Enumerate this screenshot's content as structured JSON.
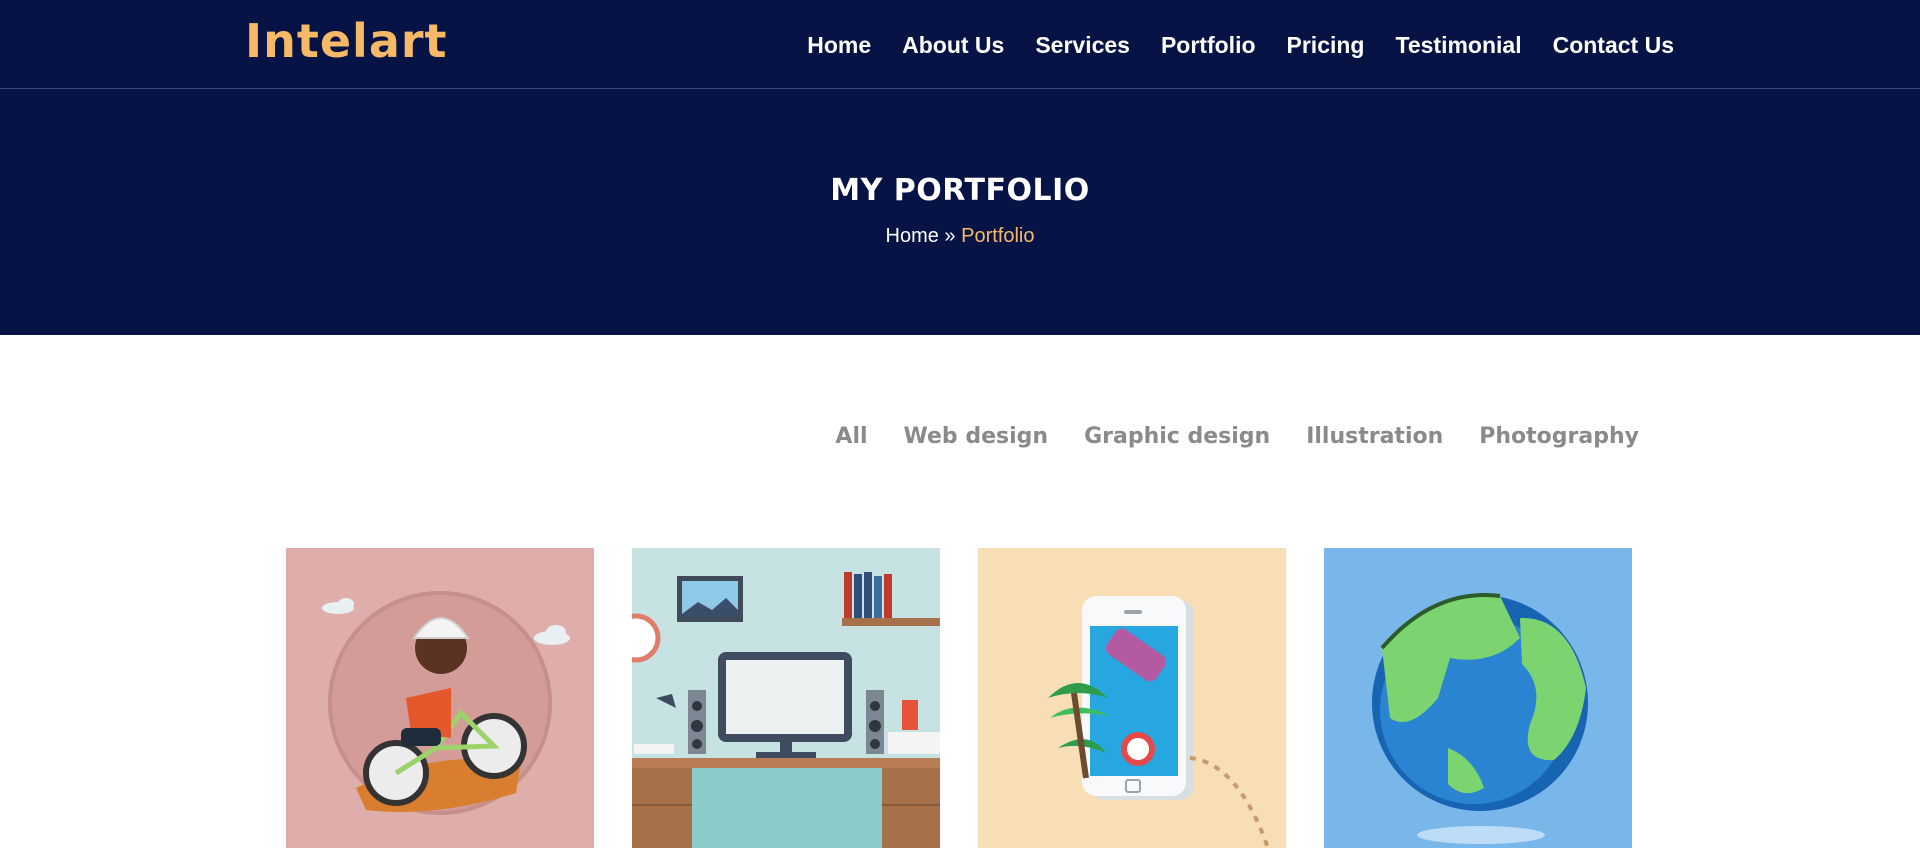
{
  "header": {
    "logo": "Intelart",
    "nav": [
      "Home",
      "About Us",
      "Services",
      "Portfolio",
      "Pricing",
      "Testimonial",
      "Contact Us"
    ]
  },
  "hero": {
    "title": "MY PORTFOLIO",
    "breadcrumb": {
      "home": "Home",
      "separator": "»",
      "current": "Portfolio"
    }
  },
  "filters": [
    "All",
    "Web design",
    "Graphic design",
    "Illustration",
    "Photography"
  ],
  "portfolio": [
    {
      "subject": "cyclist-illustration",
      "bg": "#dfaeaa"
    },
    {
      "subject": "desk-workspace-illustration",
      "bg": "#c7e2e2"
    },
    {
      "subject": "smartphone-pool-illustration",
      "bg": "#f8deb5"
    },
    {
      "subject": "globe-illustration",
      "bg": "#79b6ea"
    }
  ],
  "colors": {
    "navy": "#071245",
    "accent": "#f6b967",
    "filter_text": "#8a8a8a"
  }
}
